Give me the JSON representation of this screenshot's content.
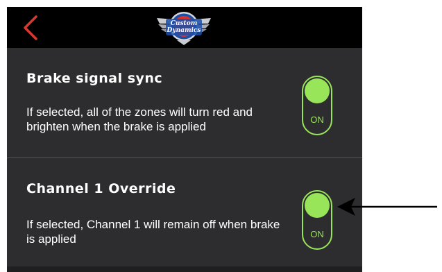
{
  "header": {
    "back_icon": "chevron-left-icon",
    "logo": {
      "line1": "Custom",
      "line2": "Dynamics"
    }
  },
  "settings": [
    {
      "title": "Brake signal sync",
      "description": "If selected, all of the zones will turn red and brighten when the brake is applied",
      "toggle_state": "ON"
    },
    {
      "title": "Channel 1 Override",
      "description": "If selected, Channel 1 will remain off when brake is applied",
      "toggle_state": "ON"
    }
  ],
  "colors": {
    "background": "#2d2d2f",
    "header": "#000000",
    "accent_red": "#d9392f",
    "toggle_green": "#98e55a",
    "text": "#ffffff"
  }
}
